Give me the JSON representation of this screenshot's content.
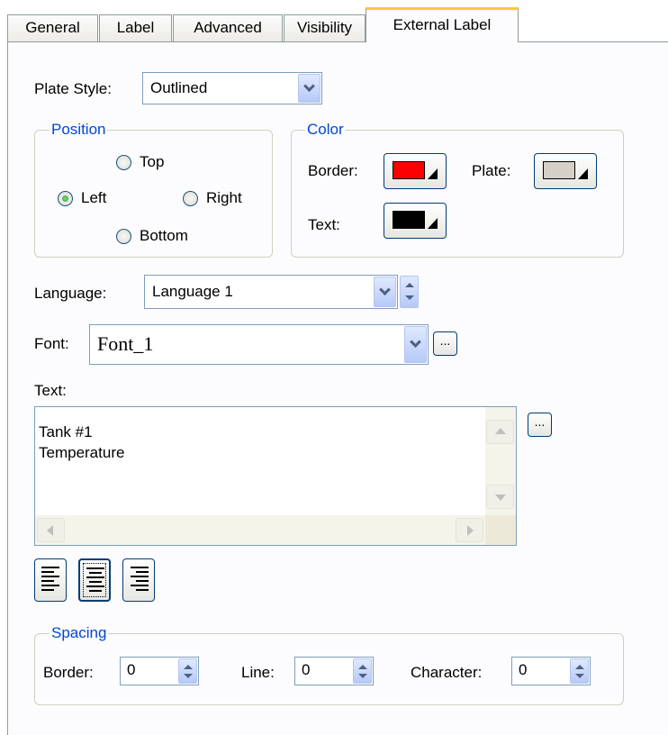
{
  "tabs": [
    "General",
    "Label",
    "Advanced",
    "Visibility",
    "External Label"
  ],
  "plate_style": {
    "label": "Plate Style:",
    "value": "Outlined"
  },
  "position": {
    "title": "Position",
    "top": "Top",
    "left": "Left",
    "right": "Right",
    "bottom": "Bottom",
    "selected": "Left"
  },
  "color": {
    "title": "Color",
    "border_label": "Border:",
    "border_color": "#ff0000",
    "plate_label": "Plate:",
    "plate_color": "#d4d0c8",
    "text_label": "Text:",
    "text_color": "#000000"
  },
  "language": {
    "label": "Language:",
    "value": "Language 1"
  },
  "font": {
    "label": "Font:",
    "value": "Font_1",
    "browse": "..."
  },
  "text": {
    "label": "Text:",
    "line1": "Tank #1",
    "line2": "Temperature",
    "browse": "..."
  },
  "alignment": {
    "selected": "center"
  },
  "spacing": {
    "title": "Spacing",
    "border_label": "Border:",
    "border_value": "0",
    "line_label": "Line:",
    "line_value": "0",
    "character_label": "Character:",
    "character_value": "0"
  }
}
